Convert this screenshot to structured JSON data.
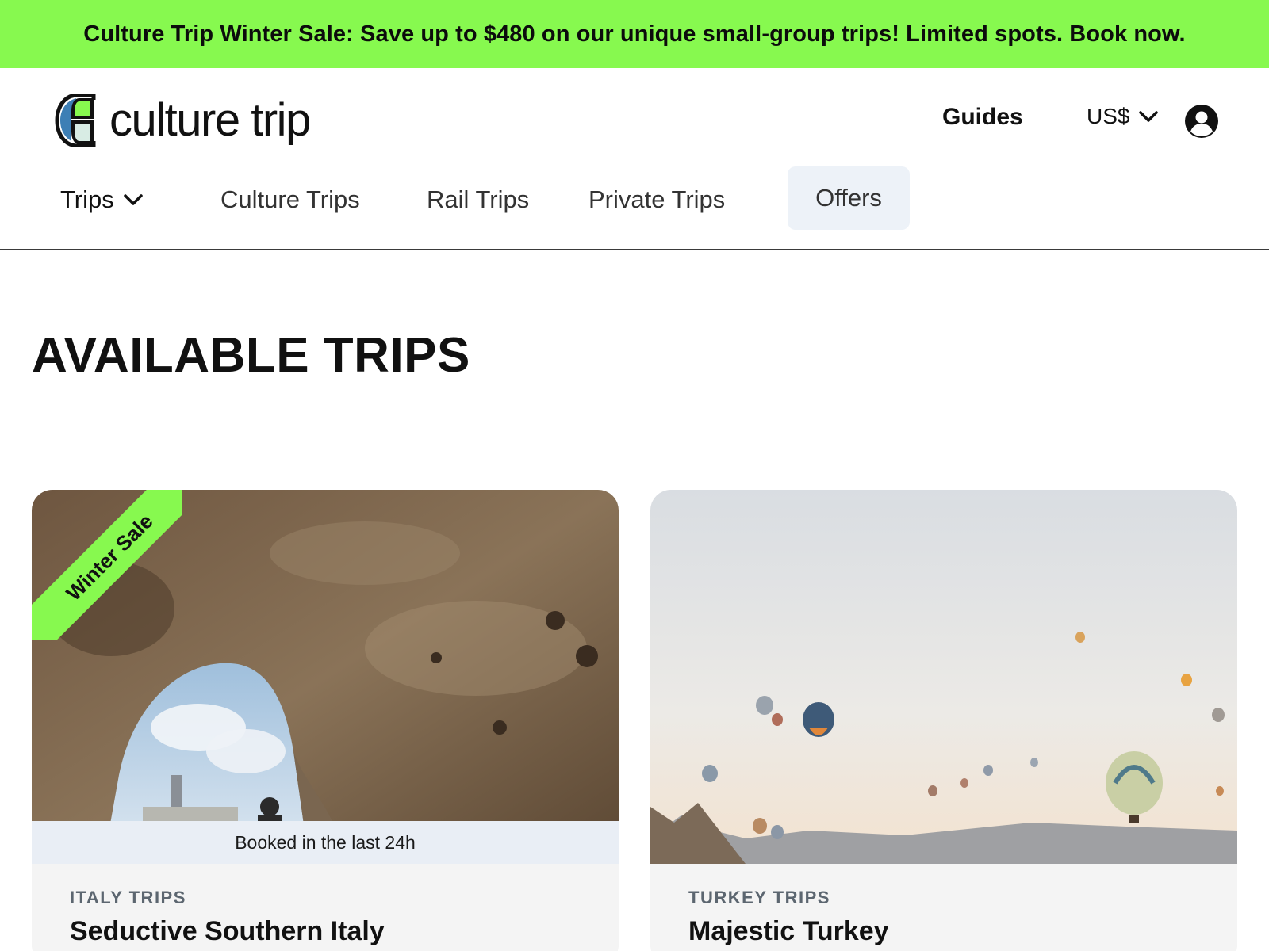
{
  "banner": {
    "text": "Culture Trip Winter Sale: Save up to $480 on our unique small-group trips! Limited spots. Book now."
  },
  "header": {
    "logo_text": "culture trip",
    "guides_label": "Guides",
    "currency_label": "US$",
    "icons": [
      "logo-mark-icon",
      "chevron-down-icon",
      "account-icon"
    ]
  },
  "nav": {
    "trips": "Trips",
    "culture_trips": "Culture Trips",
    "rail_trips": "Rail Trips",
    "private_trips": "Private Trips",
    "offers": "Offers"
  },
  "page": {
    "title": "AVAILABLE TRIPS"
  },
  "cards": [
    {
      "ribbon": "Winter Sale",
      "status": "Booked in the last 24h",
      "category": "ITALY TRIPS",
      "title": "Seductive Southern Italy"
    },
    {
      "category": "TURKEY TRIPS",
      "title": "Majestic Turkey"
    }
  ],
  "colors": {
    "accent": "#87f94f",
    "offers_bg": "#edf2f8",
    "strip_bg": "#e9eef5"
  }
}
